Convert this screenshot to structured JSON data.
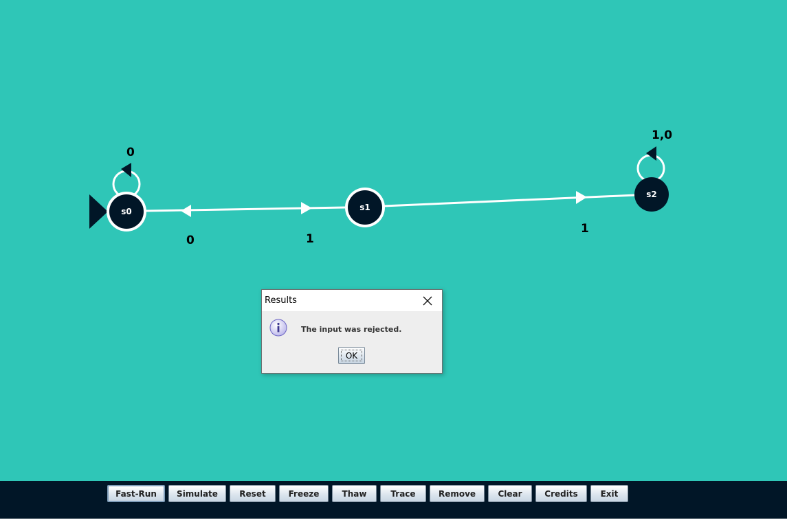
{
  "colors": {
    "canvas_bg": "#2fc6b7",
    "state_fill": "#011627",
    "edge": "#ffffff",
    "toolbar_bg": "#011627"
  },
  "automaton": {
    "states": [
      {
        "id": "s0",
        "label": "s0",
        "initial": true
      },
      {
        "id": "s1",
        "label": "s1",
        "initial": false
      },
      {
        "id": "s2",
        "label": "s2",
        "initial": false
      }
    ],
    "transitions": [
      {
        "from": "s0",
        "to": "s0",
        "label": "0"
      },
      {
        "from": "s1",
        "to": "s0",
        "label": "0"
      },
      {
        "from": "s0",
        "to": "s1",
        "label": "1"
      },
      {
        "from": "s1",
        "to": "s2",
        "label": "1"
      },
      {
        "from": "s2",
        "to": "s2",
        "label": "1,0"
      }
    ]
  },
  "dialog": {
    "title": "Results",
    "message": "The input was rejected.",
    "ok_label": "OK",
    "icon": "info-icon",
    "close_icon": "close-icon"
  },
  "toolbar": {
    "buttons": [
      {
        "label": "Fast-Run"
      },
      {
        "label": "Simulate"
      },
      {
        "label": "Reset"
      },
      {
        "label": "Freeze"
      },
      {
        "label": "Thaw"
      },
      {
        "label": "Trace"
      },
      {
        "label": "Remove"
      },
      {
        "label": "Clear"
      },
      {
        "label": "Credits"
      },
      {
        "label": "Exit"
      }
    ]
  }
}
